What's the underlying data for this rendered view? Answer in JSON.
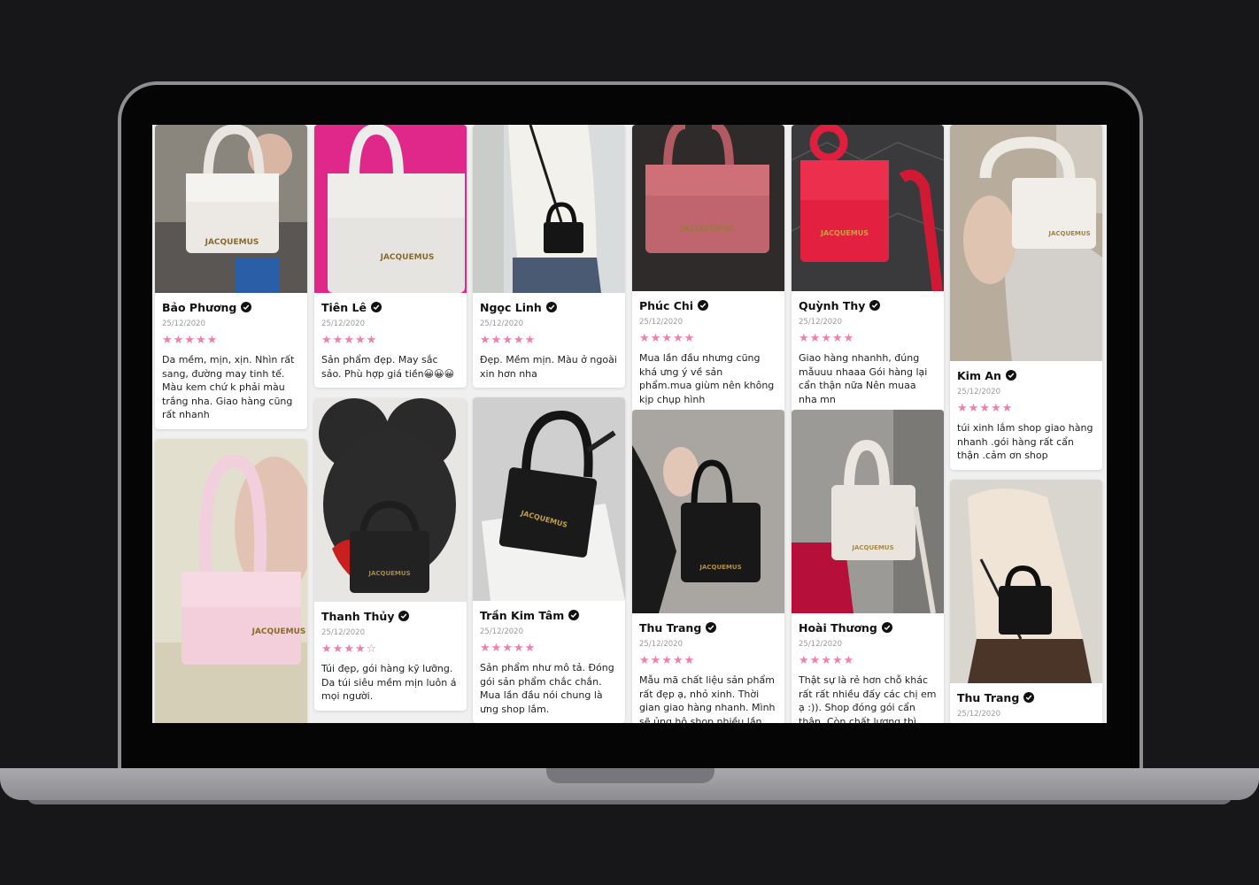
{
  "colors": {
    "background": "#17171a",
    "bezel": "#050505",
    "laptop_silver": "#8e8e93",
    "star": "#ef7fae",
    "card_bg": "#ffffff"
  },
  "reviews": [
    {
      "name": "Bảo Phương",
      "date": "25/12/2020",
      "rating": 5,
      "text": "Da mềm, mịn, xịn. Nhìn rất sang, đường may tinh tế. Màu kem chứ k phải màu trắng nha. Giao hàng cũng rất nhanh",
      "photo": "white croc mini bag held in hand",
      "logo": "JACQUEMUS"
    },
    {
      "name": "",
      "date": "",
      "rating": 0,
      "text": "",
      "photo": "pink mini bag held in hand",
      "logo": "JACQUEMUS"
    },
    {
      "name": "Tiên Lê",
      "date": "25/12/2020",
      "rating": 5,
      "text": "Sản phẩm đẹp. May sắc sảo. Phù hợp giá tiền😀😀😀",
      "photo": "white croc bag on pink background",
      "logo": "JACQUEMUS"
    },
    {
      "name": "Thanh Thủy",
      "date": "25/12/2020",
      "rating": 4,
      "text": "Túi đẹp, gói hàng kỹ lưỡng. Da túi siêu mềm mịn luôn á mọi người.",
      "photo": "black mini bag with rose teddy bear",
      "logo": "JACQUEMUS"
    },
    {
      "name": "Ngọc Linh",
      "date": "25/12/2020",
      "rating": 5,
      "text": "Đẹp. Mềm mịn. Màu ở ngoài xin hơn nha",
      "photo": "woman wearing black crossbody mini bag",
      "logo": ""
    },
    {
      "name": "Trần Kim Tâm",
      "date": "25/12/2020",
      "rating": 5,
      "text": "Sản phẩm như mô tả. Đóng gói sản phẩm chắc chắn. Mua lần đầu nói chung là ưng shop lắm.",
      "photo": "black croc bag on white paper",
      "logo": "JACQUEMUS"
    },
    {
      "name": "Phúc Chi",
      "date": "25/12/2020",
      "rating": 5,
      "text": "Mua lần đầu nhưng cũng khá ưng ý về sản phẩm.mua giùm nên không kịp chụp hình",
      "photo": "dusty pink croc bag",
      "logo": "JACQUEMUS"
    },
    {
      "name": "Thu Trang",
      "date": "25/12/2020",
      "rating": 5,
      "text": "Mẫu mã chất liệu sản phẩm rất đẹp ạ, nhỏ xinh. Thời gian giao hàng nhanh. Mình sẽ ủng hộ shop nhiều lần nữa",
      "photo": "black croc bag held by hand",
      "logo": "JACQUEMUS"
    },
    {
      "name": "Quỳnh Thy",
      "date": "25/12/2020",
      "rating": 5,
      "text": "Giao hàng nhanhh, đúng mẫuuu nhaaa Gói hàng lại cẩn thận nữa Nên muaa nha mn",
      "photo": "red bag with red strap",
      "logo": "JACQUEMUS"
    },
    {
      "name": "Hoài Thương",
      "date": "25/12/2020",
      "rating": 5,
      "text": "Thật sự là rẻ hơn chỗ khác rất rất nhiều đấy các chị em ạ :)). Shop đóng gói cẩn thận. Còn chất lượng thì khỏi bàn",
      "photo": "white croc bag held by hand",
      "logo": "JACQUEMUS"
    },
    {
      "name": "Kim An",
      "date": "25/12/2020",
      "rating": 5,
      "text": "túi xinh lắm shop giao hàng nhanh .gói hàng rất cẩn thận .cảm ơn shop",
      "photo": "white mini bag held over blanket",
      "logo": "JACQUEMUS"
    },
    {
      "name": "Thu Trang",
      "date": "25/12/2020",
      "rating": 5,
      "text": "",
      "photo": "woman with black crossbody mini bag",
      "logo": ""
    }
  ]
}
